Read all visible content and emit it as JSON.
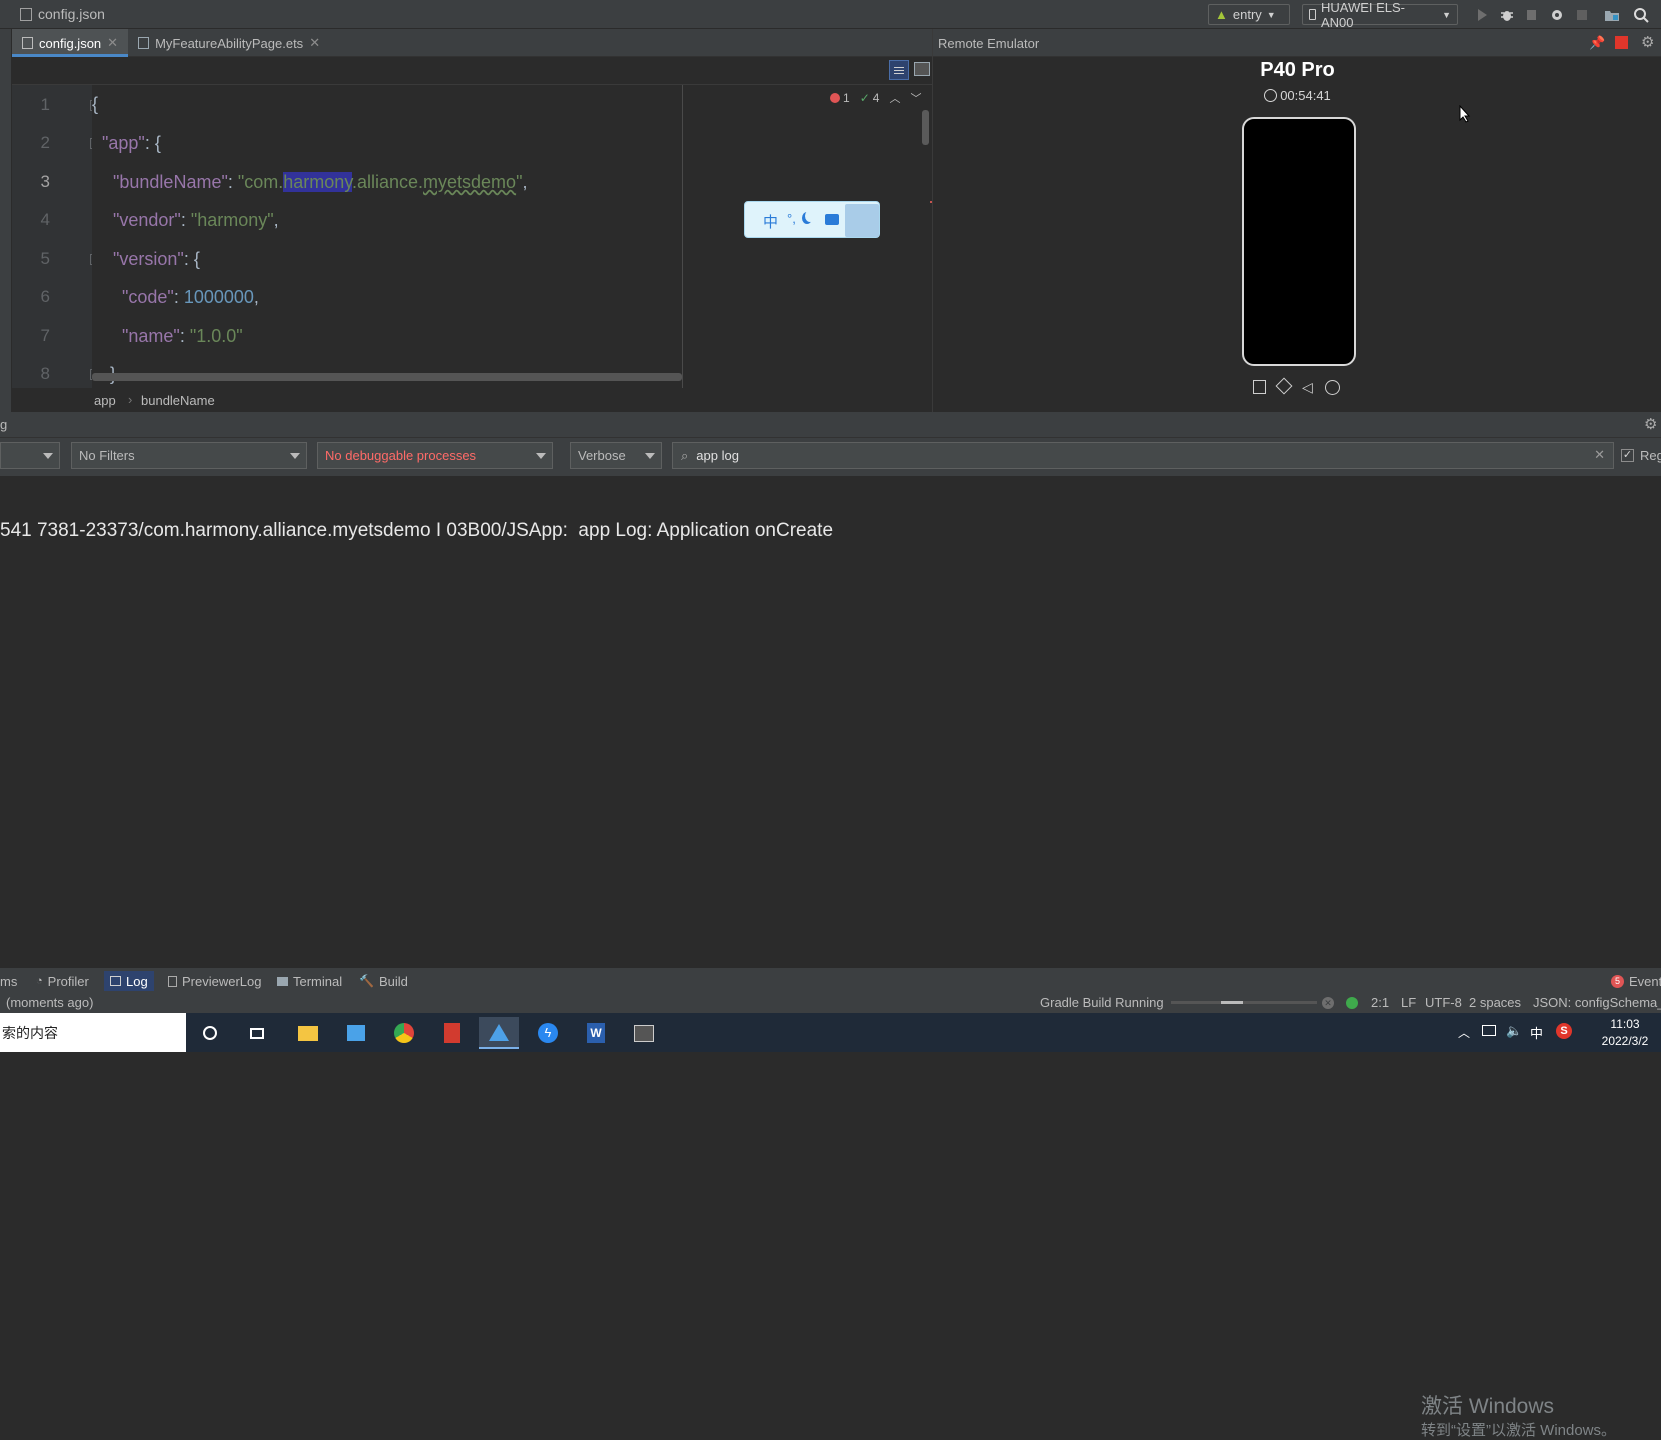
{
  "titlebar": {
    "file": "config.json",
    "run_config": "entry",
    "device": "HUAWEI ELS-AN00"
  },
  "tabs": [
    {
      "label": "config.json",
      "active": true
    },
    {
      "label": "MyFeatureAbilityPage.ets",
      "active": false
    }
  ],
  "editor": {
    "line_numbers": [
      "1",
      "2",
      "3",
      "4",
      "5",
      "6",
      "7",
      "8"
    ],
    "errors": "1",
    "warnings": "4",
    "lines": {
      "l1_brace": "{",
      "l2_key": "\"app\"",
      "l2_rest": ": {",
      "l3_key": "\"bundleName\"",
      "l3_colon": ": ",
      "l3_val_a": "\"com.",
      "l3_val_hl": "harmony",
      "l3_val_b": ".alliance.",
      "l3_val_u": "myetsdemo",
      "l3_val_c": "\"",
      "l3_comma": ",",
      "l4_key": "\"vendor\"",
      "l4_colon": ": ",
      "l4_val": "\"harmony\"",
      "l4_comma": ",",
      "l5_key": "\"version\"",
      "l5_rest": ": {",
      "l6_key": "\"code\"",
      "l6_colon": ": ",
      "l6_val": "1000000",
      "l6_comma": ",",
      "l7_key": "\"name\"",
      "l7_colon": ": ",
      "l7_val": "\"1.0.0\"",
      "l8_brace": "}"
    },
    "breadcrumb": [
      "app",
      "bundleName"
    ]
  },
  "emulator": {
    "panel_title": "Remote Emulator",
    "device_name": "P40 Pro",
    "timer": "00:54:41"
  },
  "log": {
    "tab_partial": "g",
    "filter": "No Filters",
    "process": "No debuggable processes",
    "level": "Verbose",
    "search": "app log",
    "regex_label": "Reg",
    "line": "541 7381-23373/com.harmony.alliance.myetsdemo I 03B00/JSApp:  app Log: Application onCreate"
  },
  "watermark": {
    "line1": "激活 Windows",
    "line2": "转到“设置”以激活 Windows。"
  },
  "tooltabs": {
    "problems_partial": "ms",
    "profiler": "Profiler",
    "log": "Log",
    "previewerlog": "PreviewerLog",
    "terminal": "Terminal",
    "build": "Build",
    "event": "Event",
    "event_count": "5"
  },
  "statusbar": {
    "left": "(moments ago)",
    "gradle": "Gradle Build Running",
    "position": "2:1",
    "line_sep": "LF",
    "encoding": "UTF-8",
    "indent": "2 spaces",
    "schema": "JSON: configSchema_"
  },
  "taskbar": {
    "search_text": "索的内容",
    "ime": "中",
    "time": "11:03",
    "date": "2022/3/2"
  },
  "colors": {
    "accent": "#4a88c7",
    "error": "#e05555",
    "ok": "#59a869",
    "selection": "#32329a"
  }
}
